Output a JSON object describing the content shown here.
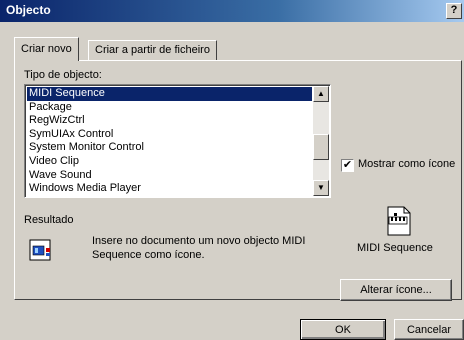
{
  "window": {
    "title": "Objecto",
    "help_button": "?"
  },
  "tabs": [
    {
      "label": "Criar novo",
      "active": true
    },
    {
      "label": "Criar a partir de ficheiro",
      "active": false
    }
  ],
  "object_type": {
    "label": "Tipo de objecto:",
    "items": [
      "MIDI Sequence",
      "Package",
      "RegWizCtrl",
      "SymUIAx Control",
      "System Monitor Control",
      "Video Clip",
      "Wave Sound",
      "Windows Media Player"
    ],
    "selected": "MIDI Sequence"
  },
  "display_as_icon": {
    "label": "Mostrar como ícone",
    "checked": true
  },
  "result": {
    "label": "Resultado",
    "text": "Insere no documento um novo objecto MIDI Sequence como ícone."
  },
  "icon_preview": {
    "caption": "MIDI Sequence",
    "icon": "midi-sequence-icon"
  },
  "buttons": {
    "change_icon": "Alterar ícone...",
    "ok": "OK",
    "cancel": "Cancelar"
  },
  "colors": {
    "titlebar": "#0a246a",
    "selection": "#0a246a",
    "face": "#d4d0c8"
  }
}
